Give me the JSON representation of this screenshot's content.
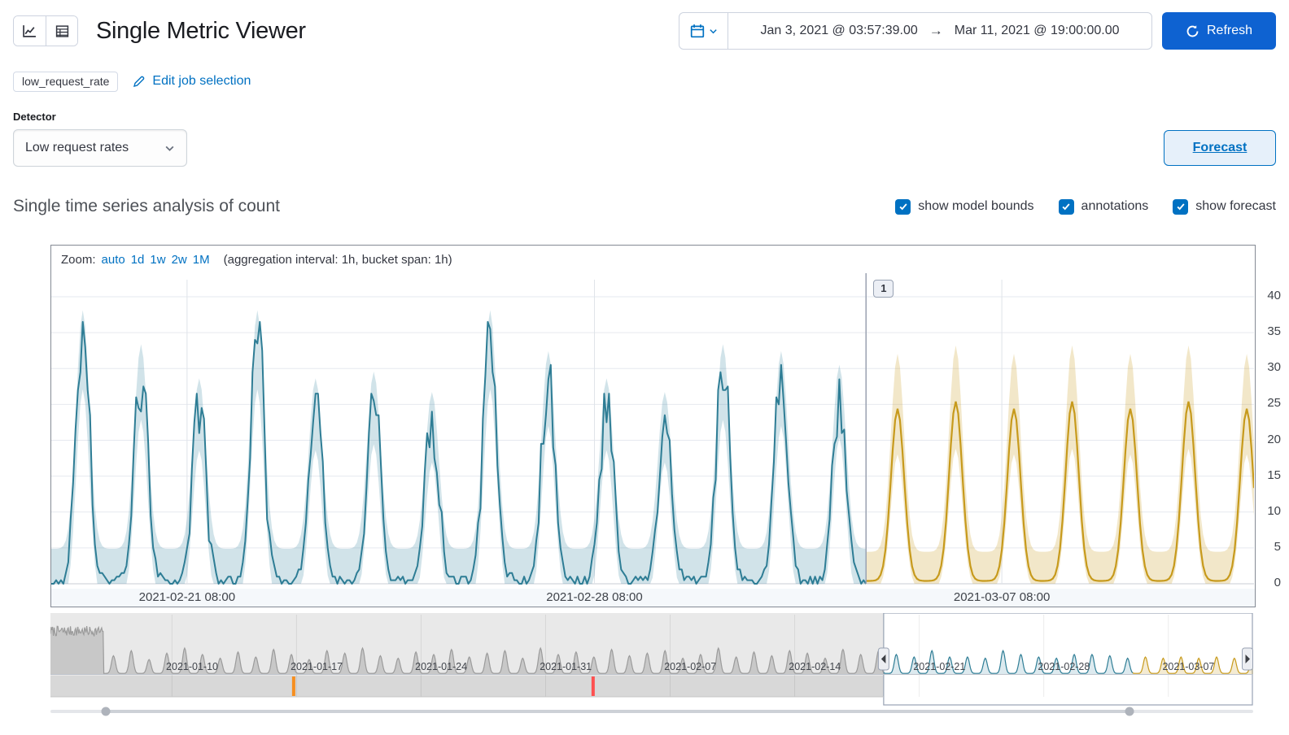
{
  "header": {
    "title": "Single Metric Viewer",
    "refresh_label": "Refresh",
    "date_start": "Jan 3, 2021 @ 03:57:39.00",
    "date_end": "Mar 11, 2021 @ 19:00:00.00",
    "range_arrow": "→"
  },
  "job": {
    "badge": "low_request_rate",
    "edit_link": "Edit job selection"
  },
  "detector": {
    "label": "Detector",
    "selected": "Low request rates",
    "forecast_button": "Forecast"
  },
  "analysis": {
    "heading": "Single time series analysis of count",
    "checkboxes": [
      {
        "label": "show model bounds",
        "checked": true
      },
      {
        "label": "annotations",
        "checked": true
      },
      {
        "label": "show forecast",
        "checked": true
      }
    ]
  },
  "zoom": {
    "label": "Zoom:",
    "options": [
      "auto",
      "1d",
      "1w",
      "2w",
      "1M"
    ],
    "note": "(aggregation interval: 1h, bucket span: 1h)"
  },
  "chart_data": {
    "type": "line",
    "title": "Single time series analysis of count",
    "x_range": [
      "2021-02-19 00:00",
      "2021-03-11 16:00"
    ],
    "total_hours": 496,
    "forecast_start_hour": 336,
    "y_ticks": [
      0,
      5,
      10,
      15,
      20,
      25,
      30,
      35,
      40
    ],
    "ylim": [
      0,
      43
    ],
    "x_tick_labels": [
      {
        "text": "2021-02-21 08:00",
        "hour": 56
      },
      {
        "text": "2021-02-28 08:00",
        "hour": 224
      },
      {
        "text": "2021-03-07 08:00",
        "hour": 392
      }
    ],
    "series": [
      {
        "name": "actual",
        "label": "count",
        "color": "#2E7D95",
        "band_fill": "rgba(44,127,154,0.22)",
        "daily_peaks": [
          35,
          30,
          25,
          35,
          25,
          26,
          23,
          35,
          29,
          25,
          23,
          30,
          29,
          27
        ],
        "upper_mul": 0.95,
        "upper_add": 4.5,
        "lower_mul": 0.85,
        "lower_add": -3
      },
      {
        "name": "model_bounds",
        "label": "model bounds",
        "note": "shaded band around actual and forecast"
      },
      {
        "name": "forecast",
        "label": "forecast",
        "color": "#C79A1C",
        "band_fill": "rgba(199,154,28,0.24)",
        "daily_peaks": [
          24,
          25,
          24,
          25,
          24,
          25,
          24
        ],
        "upper_mul": 1.15,
        "upper_add": 4,
        "lower_mul": 0.78,
        "lower_add": -1
      }
    ],
    "annotations": [
      {
        "label": "1",
        "hour": 336
      }
    ],
    "navigator": {
      "x_range": [
        "2021-01-03 04:00",
        "2021-03-11 19:00"
      ],
      "total_days": 67.6,
      "window_start_day": 46.83,
      "forecast_start_day": 60.83,
      "tick_labels": [
        {
          "text": "2021-01-10",
          "day": 7.96
        },
        {
          "text": "2021-01-17",
          "day": 14.96
        },
        {
          "text": "2021-01-24",
          "day": 21.96
        },
        {
          "text": "2021-01-31",
          "day": 28.96
        },
        {
          "text": "2021-02-07",
          "day": 35.96
        },
        {
          "text": "2021-02-14",
          "day": 42.96
        },
        {
          "text": "2021-02-21",
          "day": 49.96
        },
        {
          "text": "2021-02-28",
          "day": 56.96
        },
        {
          "text": "2021-03-07",
          "day": 63.96
        }
      ],
      "gridline_days": [
        6.83,
        13.83,
        20.83,
        27.83,
        34.83,
        41.83,
        48.83,
        55.83,
        62.83
      ],
      "daily_peaks": [
        36,
        36,
        36,
        14,
        18,
        11,
        16,
        20,
        15,
        12,
        17,
        13,
        19,
        15,
        11,
        18,
        16,
        20,
        14,
        12,
        17,
        15,
        19,
        13,
        16,
        18,
        12,
        20,
        15,
        17,
        13,
        19,
        14,
        16,
        18,
        12,
        15,
        20,
        13,
        17,
        14,
        18,
        16,
        12,
        19,
        15,
        18,
        15,
        13,
        18,
        13,
        13,
        12,
        18,
        15,
        13,
        12,
        15,
        15,
        14,
        12,
        13,
        12,
        13,
        12,
        13,
        12,
        12
      ],
      "anomalies": [
        {
          "day": 13.67,
          "color": "#F68F20",
          "severity": "major"
        },
        {
          "day": 30.5,
          "color": "#FE5050",
          "severity": "critical"
        }
      ]
    }
  },
  "colors": {
    "link_blue": "#0071C2",
    "primary_button": "#0E62D1",
    "checkbox": "#0071C2",
    "nav_gray_line": "#9b9b9b",
    "nav_gray_fill": "rgba(140,140,140,0.35)",
    "divider": "#9aa2b1"
  }
}
